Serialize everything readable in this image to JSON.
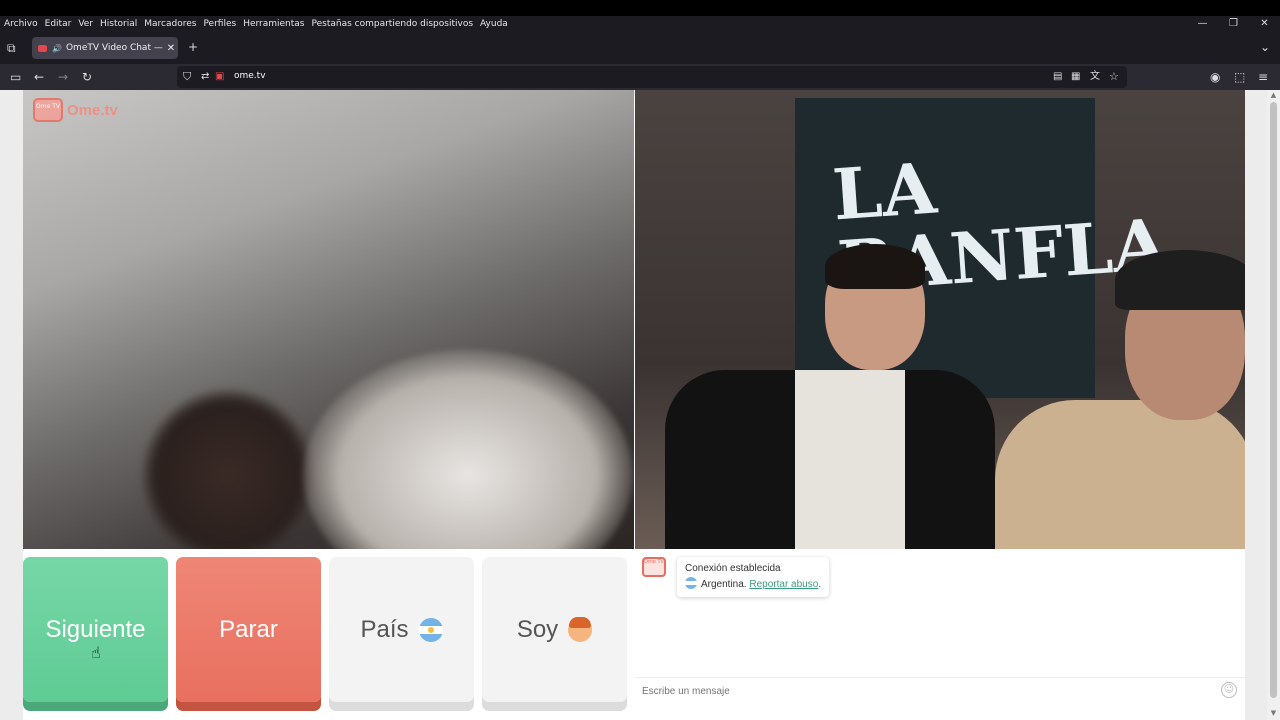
{
  "browser": {
    "menu": [
      "Archivo",
      "Editar",
      "Ver",
      "Historial",
      "Marcadores",
      "Perfiles",
      "Herramientas",
      "Pestañas compartiendo dispositivos",
      "Ayuda"
    ],
    "tab_title": "OmeTV Video Chat — Ome",
    "tab_close": "✕",
    "new_tab": "+",
    "url": "ome.tv",
    "window_controls": [
      "—",
      "❐",
      "✕"
    ]
  },
  "app": {
    "logo_text": "Ome.tv",
    "logo_badge": "Ome TV",
    "buttons": {
      "next": "Siguiente",
      "stop": "Parar",
      "country": "País",
      "me": "Soy"
    },
    "remote_banner": "LA RANFLA",
    "chat": {
      "status": "Conexión establecida",
      "country": "Argentina.",
      "report": "Reportar abuso",
      "period": ".",
      "placeholder": "Escribe un mensaje"
    }
  },
  "colors": {
    "next": "#5fcb95",
    "stop": "#e8705f",
    "accent_link": "#3b9b7e"
  }
}
